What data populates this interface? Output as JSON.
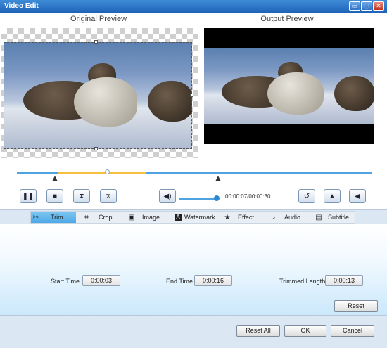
{
  "window": {
    "title": "Video Edit",
    "minimize_glyph": "▭",
    "maximize_glyph": "▢",
    "close_glyph": "✕"
  },
  "previews": {
    "original_label": "Original Preview",
    "output_label": "Output Preview"
  },
  "controls": {
    "pause_glyph": "❚❚",
    "stop_glyph": "■",
    "clip_start_glyph": "⧗",
    "clip_end_glyph": "⧖",
    "volume_glyph": "◀)",
    "time_readout": "00:00:07/00:00:30",
    "undo_glyph": "↺",
    "flip_v_glyph": "▲",
    "flip_h_glyph": "◀"
  },
  "tabs": [
    {
      "label": "Trim",
      "icon": "scissors-icon",
      "glyph": "✂"
    },
    {
      "label": "Crop",
      "icon": "crop-icon",
      "glyph": "⌗"
    },
    {
      "label": "Image",
      "icon": "image-icon",
      "glyph": "▣"
    },
    {
      "label": "Watermark",
      "icon": "watermark-icon",
      "glyph": "A"
    },
    {
      "label": "Effect",
      "icon": "star-icon",
      "glyph": "★"
    },
    {
      "label": "Audio",
      "icon": "music-note-icon",
      "glyph": "♪"
    },
    {
      "label": "Subtitle",
      "icon": "subtitle-icon",
      "glyph": "▤"
    }
  ],
  "trim": {
    "start_label": "Start Time",
    "start_value": "0:00:03",
    "end_label": "End Time",
    "end_value": "0:00:16",
    "length_label": "Trimmed Length",
    "length_value": "0:00:13",
    "reset_label": "Reset"
  },
  "footer": {
    "reset_all_label": "Reset All",
    "ok_label": "OK",
    "cancel_label": "Cancel"
  },
  "colors": {
    "accent": "#4fa3e0",
    "trim_range": "#f5c040",
    "active_tab": "#5eb3ea"
  }
}
